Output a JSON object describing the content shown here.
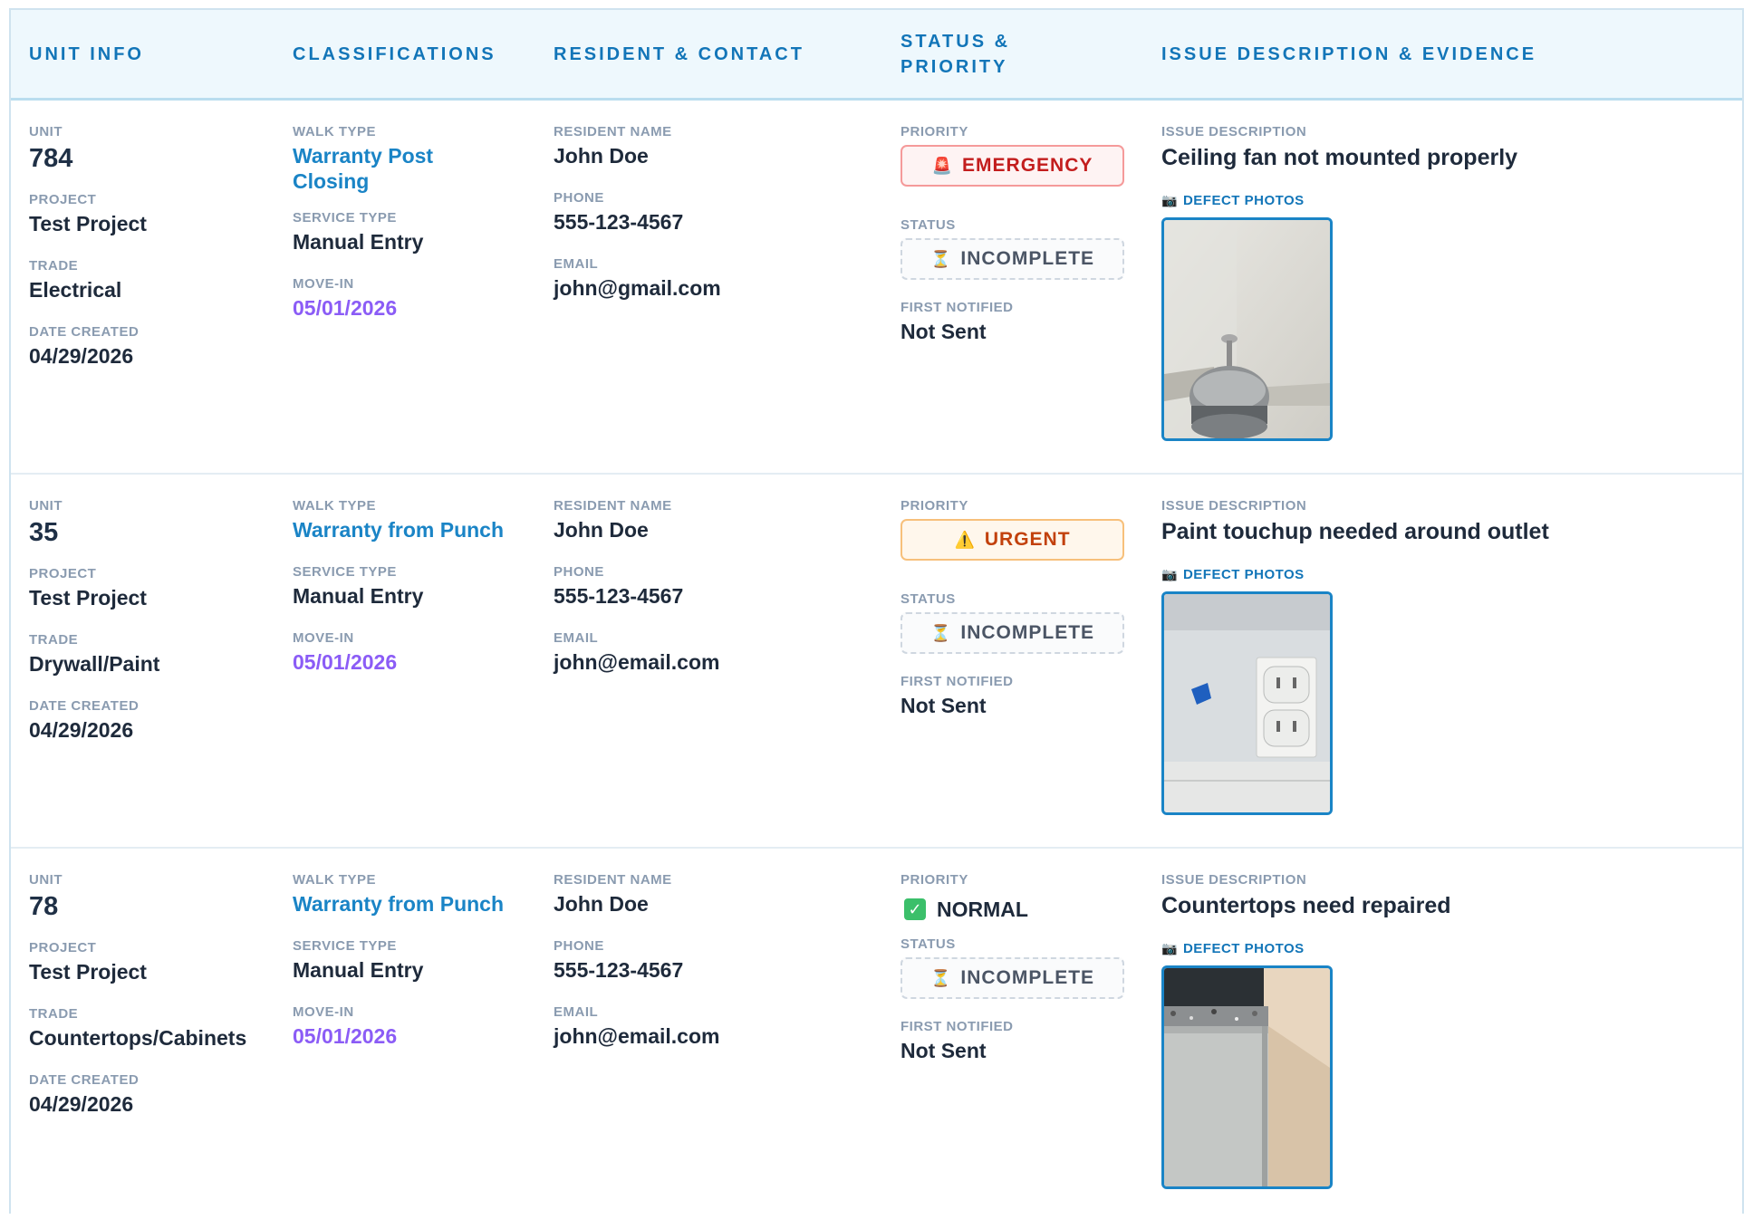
{
  "headers": [
    "UNIT INFO",
    "CLASSIFICATIONS",
    "RESIDENT & CONTACT",
    "STATUS & PRIORITY",
    "ISSUE DESCRIPTION & EVIDENCE"
  ],
  "labels": {
    "unit": "UNIT",
    "project": "PROJECT",
    "trade": "TRADE",
    "date_created": "DATE CREATED",
    "walk_type": "WALK TYPE",
    "service_type": "SERVICE TYPE",
    "move_in": "MOVE-IN",
    "resident_name": "RESIDENT NAME",
    "phone": "PHONE",
    "email": "EMAIL",
    "priority": "PRIORITY",
    "status": "STATUS",
    "first_notified": "FIRST NOTIFIED",
    "issue_description": "ISSUE DESCRIPTION",
    "defect_photos": "DEFECT PHOTOS"
  },
  "rows": [
    {
      "unit": "784",
      "project": "Test Project",
      "trade": "Electrical",
      "date_created": "04/29/2026",
      "walk_type": "Warranty Post Closing",
      "service_type": "Manual Entry",
      "move_in": "05/01/2026",
      "resident_name": "John Doe",
      "phone": "555-123-4567",
      "email": "john@gmail.com",
      "priority": "EMERGENCY",
      "priority_icon": "siren-icon",
      "status": "INCOMPLETE",
      "first_notified": "Not Sent",
      "issue": "Ceiling fan not mounted properly",
      "photo": "ceiling-fan-photo"
    },
    {
      "unit": "35",
      "project": "Test Project",
      "trade": "Drywall/Paint",
      "date_created": "04/29/2026",
      "walk_type": "Warranty from Punch",
      "service_type": "Manual Entry",
      "move_in": "05/01/2026",
      "resident_name": "John Doe",
      "phone": "555-123-4567",
      "email": "john@email.com",
      "priority": "URGENT",
      "priority_icon": "warning-icon",
      "status": "INCOMPLETE",
      "first_notified": "Not Sent",
      "issue": "Paint touchup needed around outlet",
      "photo": "wall-outlet-photo"
    },
    {
      "unit": "78",
      "project": "Test Project",
      "trade": "Countertops/Cabinets",
      "date_created": "04/29/2026",
      "walk_type": "Warranty from Punch",
      "service_type": "Manual Entry",
      "move_in": "05/01/2026",
      "resident_name": "John Doe",
      "phone": "555-123-4567",
      "email": "john@email.com",
      "priority": "NORMAL",
      "priority_icon": "check-icon",
      "status": "INCOMPLETE",
      "first_notified": "Not Sent",
      "issue": "Countertops need repaired",
      "photo": "countertop-photo"
    }
  ],
  "colors": {
    "header_text": "#1275b8",
    "move_in": "#8b5cf6",
    "walk_type": "#1a84c6",
    "emergency": "#c31d1d",
    "urgent": "#c2410c",
    "normal_check": "#3bbf6a"
  }
}
